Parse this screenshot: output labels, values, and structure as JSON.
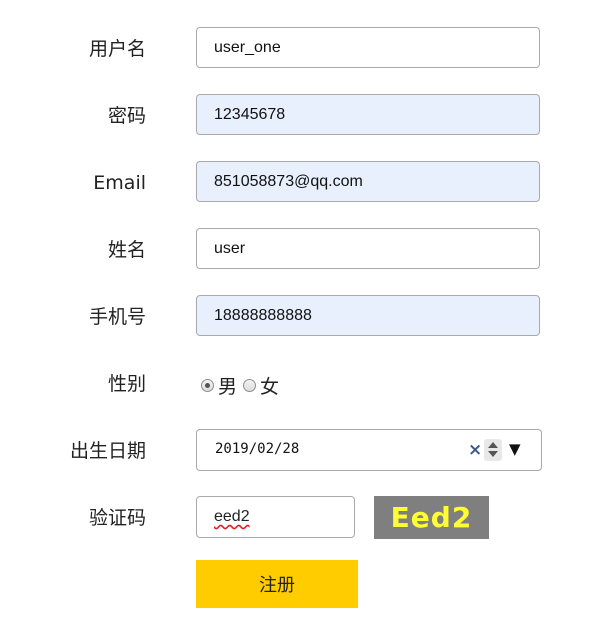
{
  "form": {
    "username": {
      "label": "用户名",
      "value": "user_one"
    },
    "password": {
      "label": "密码",
      "value": "12345678"
    },
    "email": {
      "label": "Email",
      "value": "851058873@qq.com"
    },
    "name": {
      "label": "姓名",
      "value": "user"
    },
    "phone": {
      "label": "手机号",
      "value": "18888888888"
    },
    "gender": {
      "label": "性别",
      "options": [
        {
          "label": "男",
          "checked": true
        },
        {
          "label": "女",
          "checked": false
        }
      ]
    },
    "birthday": {
      "label": "出生日期",
      "value": "2019/02/28",
      "clear_icon": "×",
      "dropdown_icon": "▼"
    },
    "captcha": {
      "label": "验证码",
      "value": "eed2",
      "image_text": "Eed2"
    },
    "submit_label": "注册"
  },
  "colors": {
    "autofill_background": "#e8f0fe",
    "button_background": "#ffcc00",
    "captcha_background": "#7f7f7f",
    "captcha_text": "#ffff33"
  }
}
